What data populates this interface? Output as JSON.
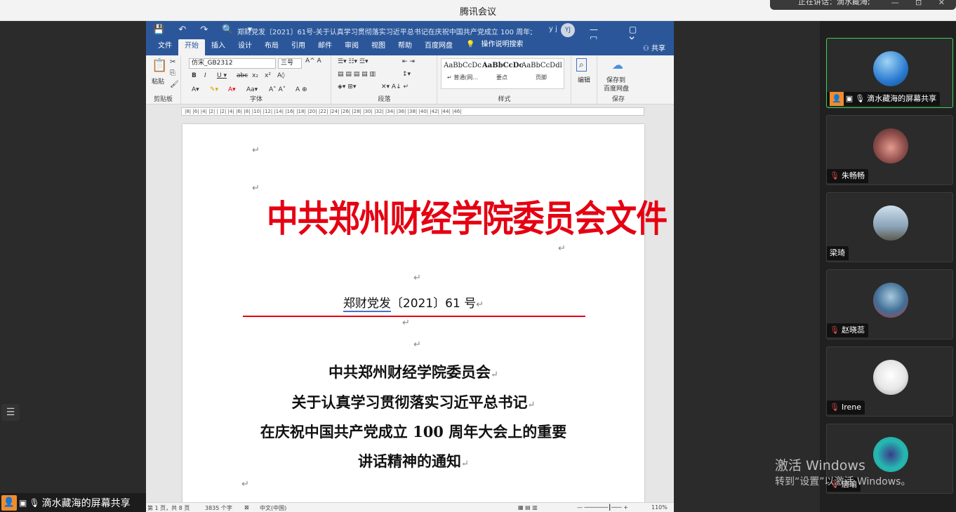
{
  "app": {
    "title": "腾讯会议"
  },
  "notif": {
    "text": "正在讲话：滴水藏海;",
    "controls": "— ⊡ ✕"
  },
  "sharing": {
    "label": "滴水藏海的屏幕共享"
  },
  "word": {
    "doc_title": "郑财党发〔2021〕61号-关于认真学习贯彻落实习近平总书记在庆祝中国共产党成立 100 周年大会上的...",
    "user_initials": "YJ",
    "user_letters": "y j",
    "window_controls": "— ▢ □ ✕",
    "quick_access": "💾 ↶ ↷ 🔍 ▾",
    "tabs": [
      "文件",
      "开始",
      "插入",
      "设计",
      "布局",
      "引用",
      "邮件",
      "审阅",
      "视图",
      "帮助",
      "百度网盘"
    ],
    "search_label": "操作说明搜索",
    "share_label": "共享",
    "ribbon": {
      "paste": "粘贴",
      "clipboard": "剪贴板",
      "font_name": "仿宋_GB2312",
      "font_size": "三号",
      "font_group": "字体",
      "para_group": "段落",
      "styles_group": "样式",
      "edit_label": "编辑",
      "save_to": "保存到",
      "save_to2": "百度网盘",
      "save_group": "保存",
      "style_items": [
        {
          "preview": "AaBbCcDc",
          "name": "↵ 普通(网..."
        },
        {
          "preview": "AaBbCcDc",
          "name": "要点"
        },
        {
          "preview": "AaBbCcDdl",
          "name": "页脚"
        }
      ]
    },
    "ruler_text": "|8| |6| |4| |2| | |2| |4| |6| |8| |10| |12| |14| |16| |18| |20| |22| |24| |26| |28| |30| |32| |34| |36| |38| |40| |42| |44| |46|",
    "content": {
      "red_title": "中共郑州财经学院委员会文件",
      "doc_number_underlined": "郑财党发",
      "doc_number_rest": "〔2021〕61 号",
      "heading_lines": [
        "中共郑州财经学院委员会",
        "关于认真学习贯彻落实习近平总书记",
        "在庆祝中国共产党成立 100 周年大会上的重要",
        "讲话精神的通知"
      ],
      "para_mark": "↵"
    },
    "status": {
      "page": "第 1 页，共 8 页",
      "words": "3835 个字",
      "lang": "中文(中国)",
      "zoom": "110%"
    }
  },
  "participants": [
    {
      "name": "滴水藏海的屏幕共享",
      "muted": false,
      "active": true
    },
    {
      "name": "朱畅畅",
      "muted": true,
      "active": false
    },
    {
      "name": "梁琦",
      "muted": false,
      "active": false
    },
    {
      "name": "赵晓蕊",
      "muted": true,
      "active": false
    },
    {
      "name": "Irene",
      "muted": true,
      "active": false
    },
    {
      "name": "唐瑜",
      "muted": true,
      "active": false
    }
  ],
  "watermark": {
    "line1": "激活 Windows",
    "line2": "转到“设置”以激活 Windows。"
  }
}
